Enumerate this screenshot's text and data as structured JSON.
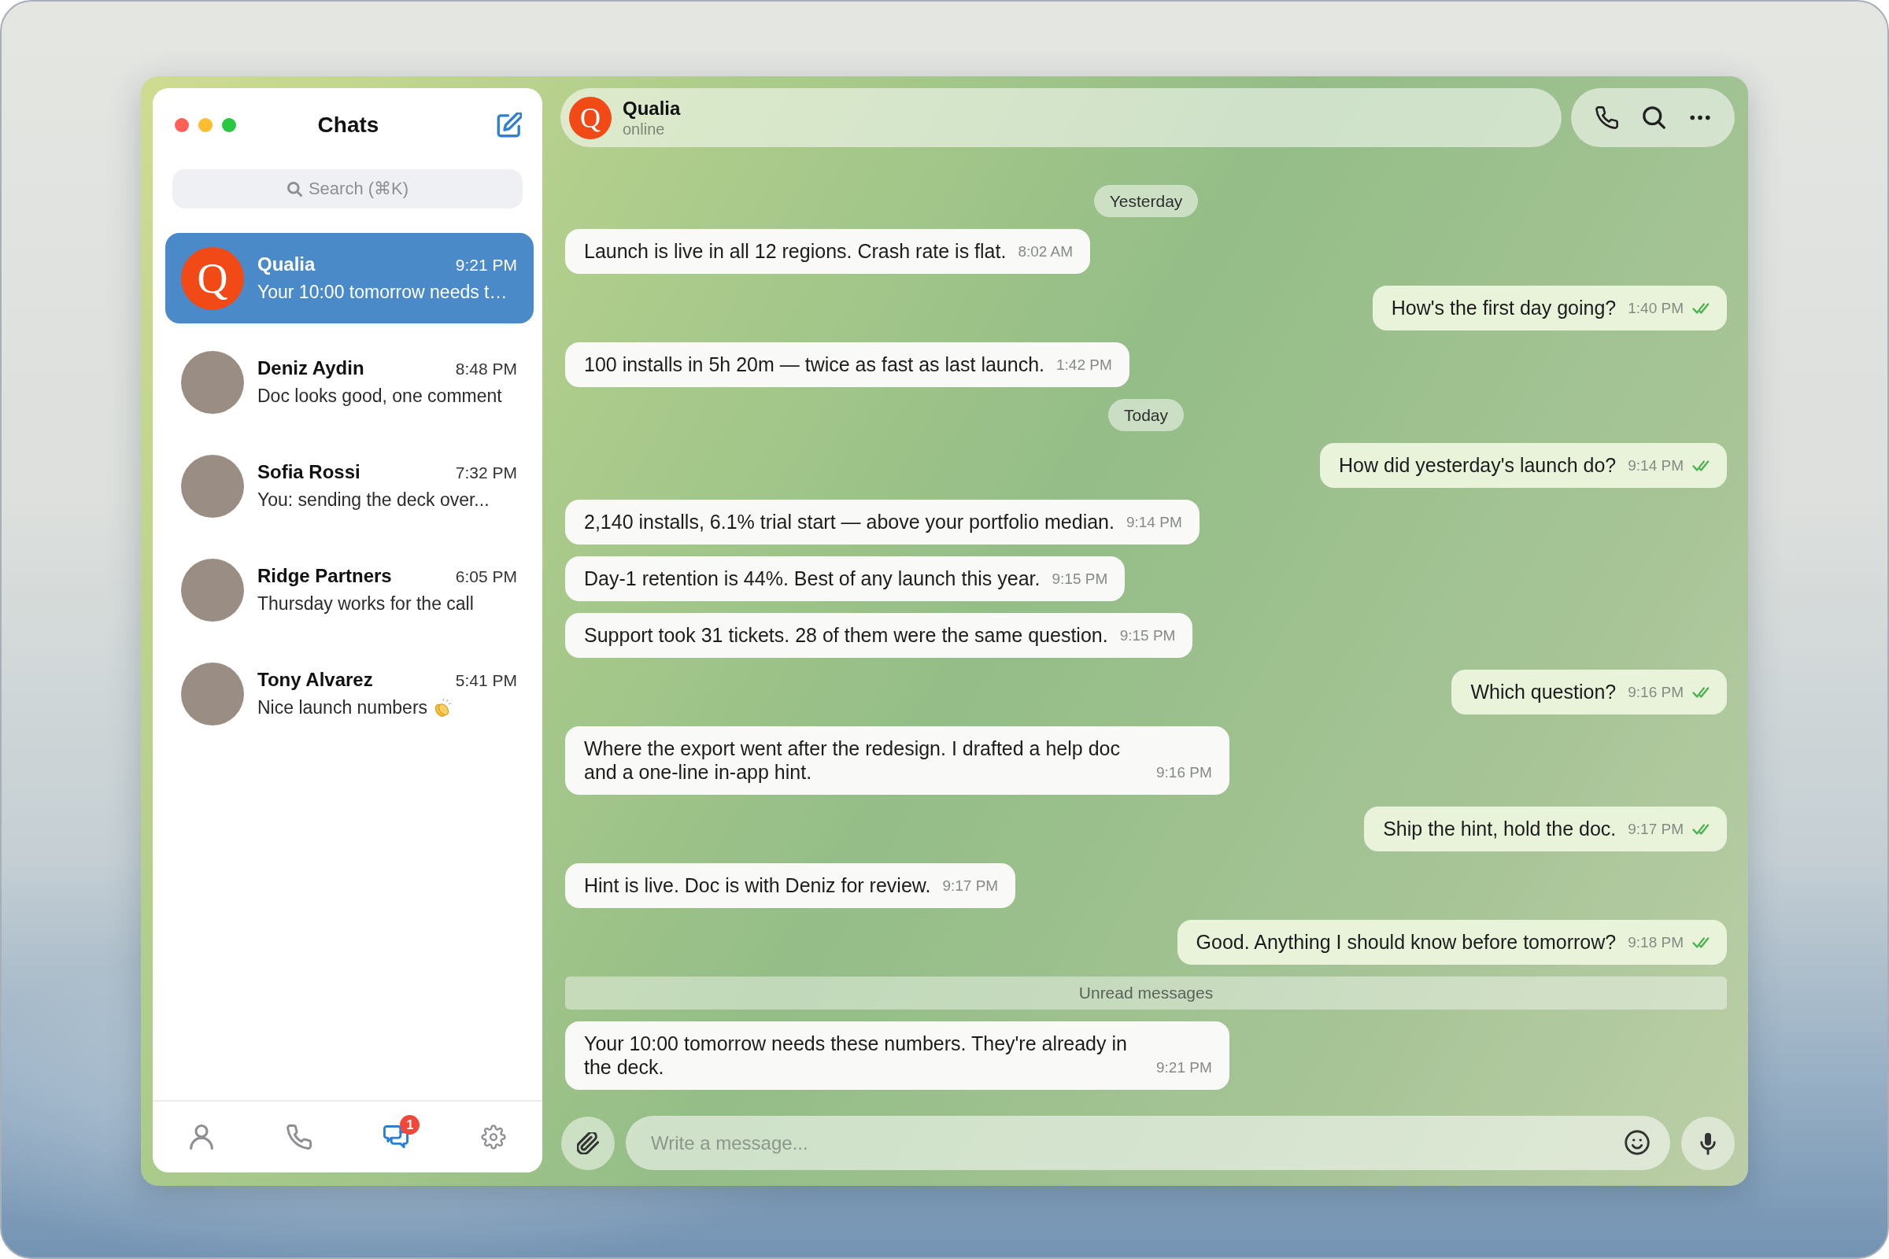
{
  "sidebar": {
    "title": "Chats",
    "search": {
      "placeholder": "Search (⌘K)"
    },
    "chats": [
      {
        "name": "Qualia",
        "time": "9:21 PM",
        "preview": "Your 10:00 tomorrow needs t…",
        "avatar": {
          "kind": "letter",
          "letter": "Q"
        },
        "emoji": false,
        "selected": true
      },
      {
        "name": "Deniz Aydin",
        "time": "8:48 PM",
        "preview": "Doc looks good, one comment",
        "avatar": {
          "kind": "photo"
        },
        "emoji": false,
        "selected": false
      },
      {
        "name": "Sofia Rossi",
        "time": "7:32 PM",
        "preview": "You: sending the deck over...",
        "avatar": {
          "kind": "photo"
        },
        "emoji": false,
        "selected": false
      },
      {
        "name": "Ridge Partners",
        "time": "6:05 PM",
        "preview": "Thursday works for the call",
        "avatar": {
          "kind": "photo"
        },
        "emoji": false,
        "selected": false
      },
      {
        "name": "Tony Alvarez",
        "time": "5:41 PM",
        "preview": "Nice launch numbers",
        "avatar": {
          "kind": "photo"
        },
        "emoji": true,
        "selected": false
      }
    ],
    "nav": [
      {
        "kind": "contacts",
        "selected": false
      },
      {
        "kind": "calls",
        "selected": false
      },
      {
        "kind": "chats",
        "selected": true,
        "badge": "1"
      },
      {
        "kind": "settings",
        "selected": false
      }
    ]
  },
  "chat": {
    "header": {
      "avatar_letter": "Q",
      "name": "Qualia",
      "status": "online"
    },
    "messages": [
      {
        "kind": "date",
        "text": "Yesterday"
      },
      {
        "kind": "incoming",
        "text": "Launch is live in all 12 regions. Crash rate is flat.",
        "time": "8:02 AM"
      },
      {
        "kind": "outgoing",
        "text": "How's the first day going?",
        "time": "1:40 PM",
        "read": true
      },
      {
        "kind": "incoming",
        "text": "100 installs in 5h 20m — twice as fast as last launch.",
        "time": "1:42 PM"
      },
      {
        "kind": "date",
        "text": "Today"
      },
      {
        "kind": "outgoing",
        "text": "How did yesterday's launch do?",
        "time": "9:14 PM",
        "read": true
      },
      {
        "kind": "incoming",
        "text": "2,140 installs, 6.1% trial start — above your portfolio median.",
        "time": "9:14 PM"
      },
      {
        "kind": "incoming",
        "text": "Day-1 retention is 44%. Best of any launch this year.",
        "time": "9:15 PM"
      },
      {
        "kind": "incoming",
        "text": "Support took 31 tickets. 28 of them were the same question.",
        "time": "9:15 PM"
      },
      {
        "kind": "outgoing",
        "text": "Which question?",
        "time": "9:16 PM",
        "read": true
      },
      {
        "kind": "incoming",
        "text": "Where the export went after the redesign. I drafted a help doc and a one-line in-app hint.",
        "time": "9:16 PM"
      },
      {
        "kind": "outgoing",
        "text": "Ship the hint, hold the doc.",
        "time": "9:17 PM",
        "read": true
      },
      {
        "kind": "incoming",
        "text": "Hint is live. Doc is with Deniz for review.",
        "time": "9:17 PM"
      },
      {
        "kind": "outgoing",
        "text": "Good. Anything I should know before tomorrow?",
        "time": "9:18 PM",
        "read": true
      },
      {
        "kind": "unread_divider",
        "text": "Unread messages"
      },
      {
        "kind": "incoming",
        "text": "Your 10:00 tomorrow needs these numbers. They're already in the deck.",
        "time": "9:21 PM"
      }
    ],
    "composer": {
      "placeholder": "Write a message..."
    }
  }
}
